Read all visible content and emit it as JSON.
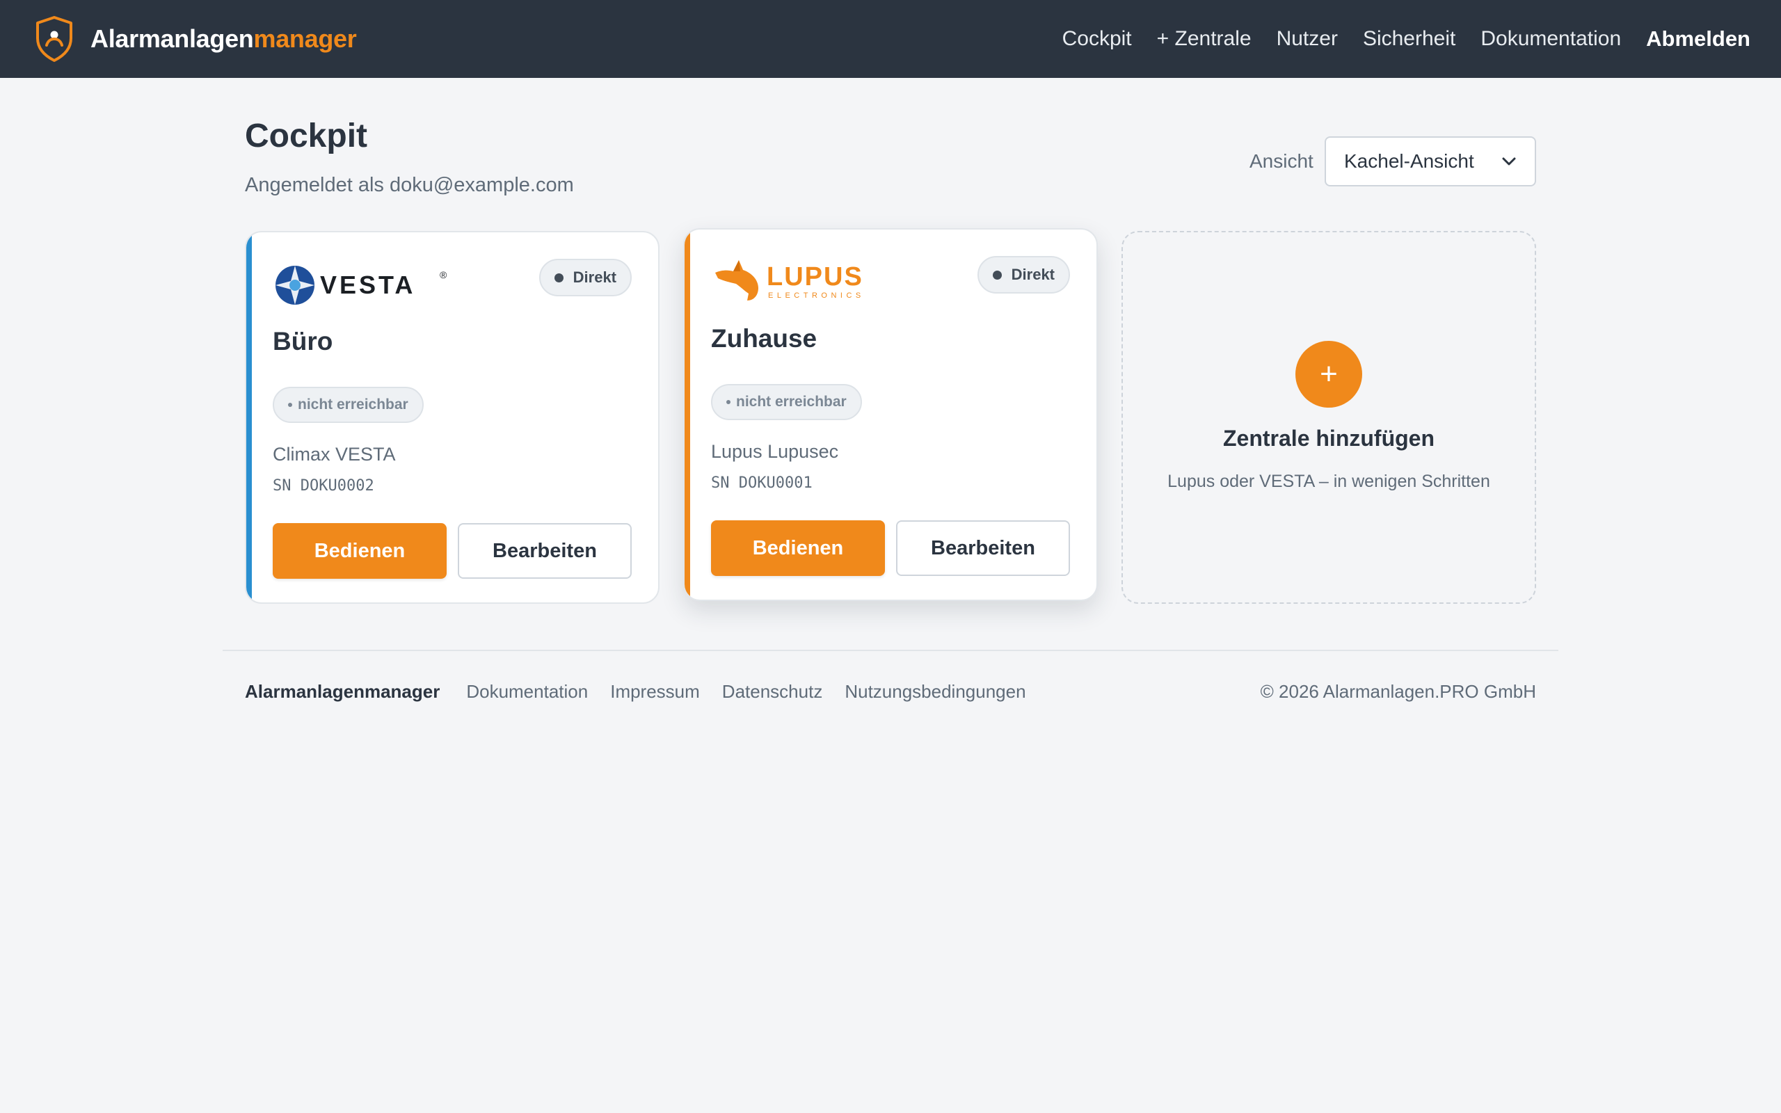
{
  "header": {
    "brand_white": "Alarmanlagen",
    "brand_orange": "manager",
    "nav": {
      "cockpit": "Cockpit",
      "zentrale": "+ Zentrale",
      "nutzer": "Nutzer",
      "sicherheit": "Sicherheit",
      "dokumentation": "Dokumentation",
      "abmelden": "Abmelden"
    }
  },
  "page": {
    "title": "Cockpit",
    "subtitle": "Angemeldet als doku@example.com",
    "view_label": "Ansicht",
    "view_selected": "Kachel-Ansicht"
  },
  "cards": [
    {
      "logo_text": "VESTA",
      "logo_mark": "®",
      "connection": "Direkt",
      "name": "Büro",
      "status": "nicht erreichbar",
      "model": "Climax VESTA",
      "serial": "SN DOKU0002",
      "primary": "Bedienen",
      "secondary": "Bearbeiten",
      "accent": "#2a8fd0"
    },
    {
      "logo_text": "LUPUS",
      "logo_sub": "ELECTRONICS",
      "connection": "Direkt",
      "name": "Zuhause",
      "status": "nicht erreichbar",
      "model": "Lupus Lupusec",
      "serial": "SN DOKU0001",
      "primary": "Bedienen",
      "secondary": "Bearbeiten",
      "accent": "#f0891b"
    }
  ],
  "add_card": {
    "icon": "+",
    "title": "Zentrale hinzufügen",
    "subtitle": "Lupus oder VESTA – in wenigen Schritten"
  },
  "footer": {
    "brand": "Alarmanlagenmanager",
    "links": [
      "Dokumentation",
      "Impressum",
      "Datenschutz",
      "Nutzungsbedingungen"
    ],
    "copyright": "© 2026 Alarmanlagen.PRO GmbH"
  },
  "colors": {
    "navbar": "#2b3440",
    "accent_orange": "#f0891b",
    "accent_blue": "#2a8fd0",
    "background": "#f4f5f7"
  },
  "icons": {
    "brand": "shield-user-icon",
    "select": "chevron-down-icon",
    "add": "plus-icon"
  }
}
